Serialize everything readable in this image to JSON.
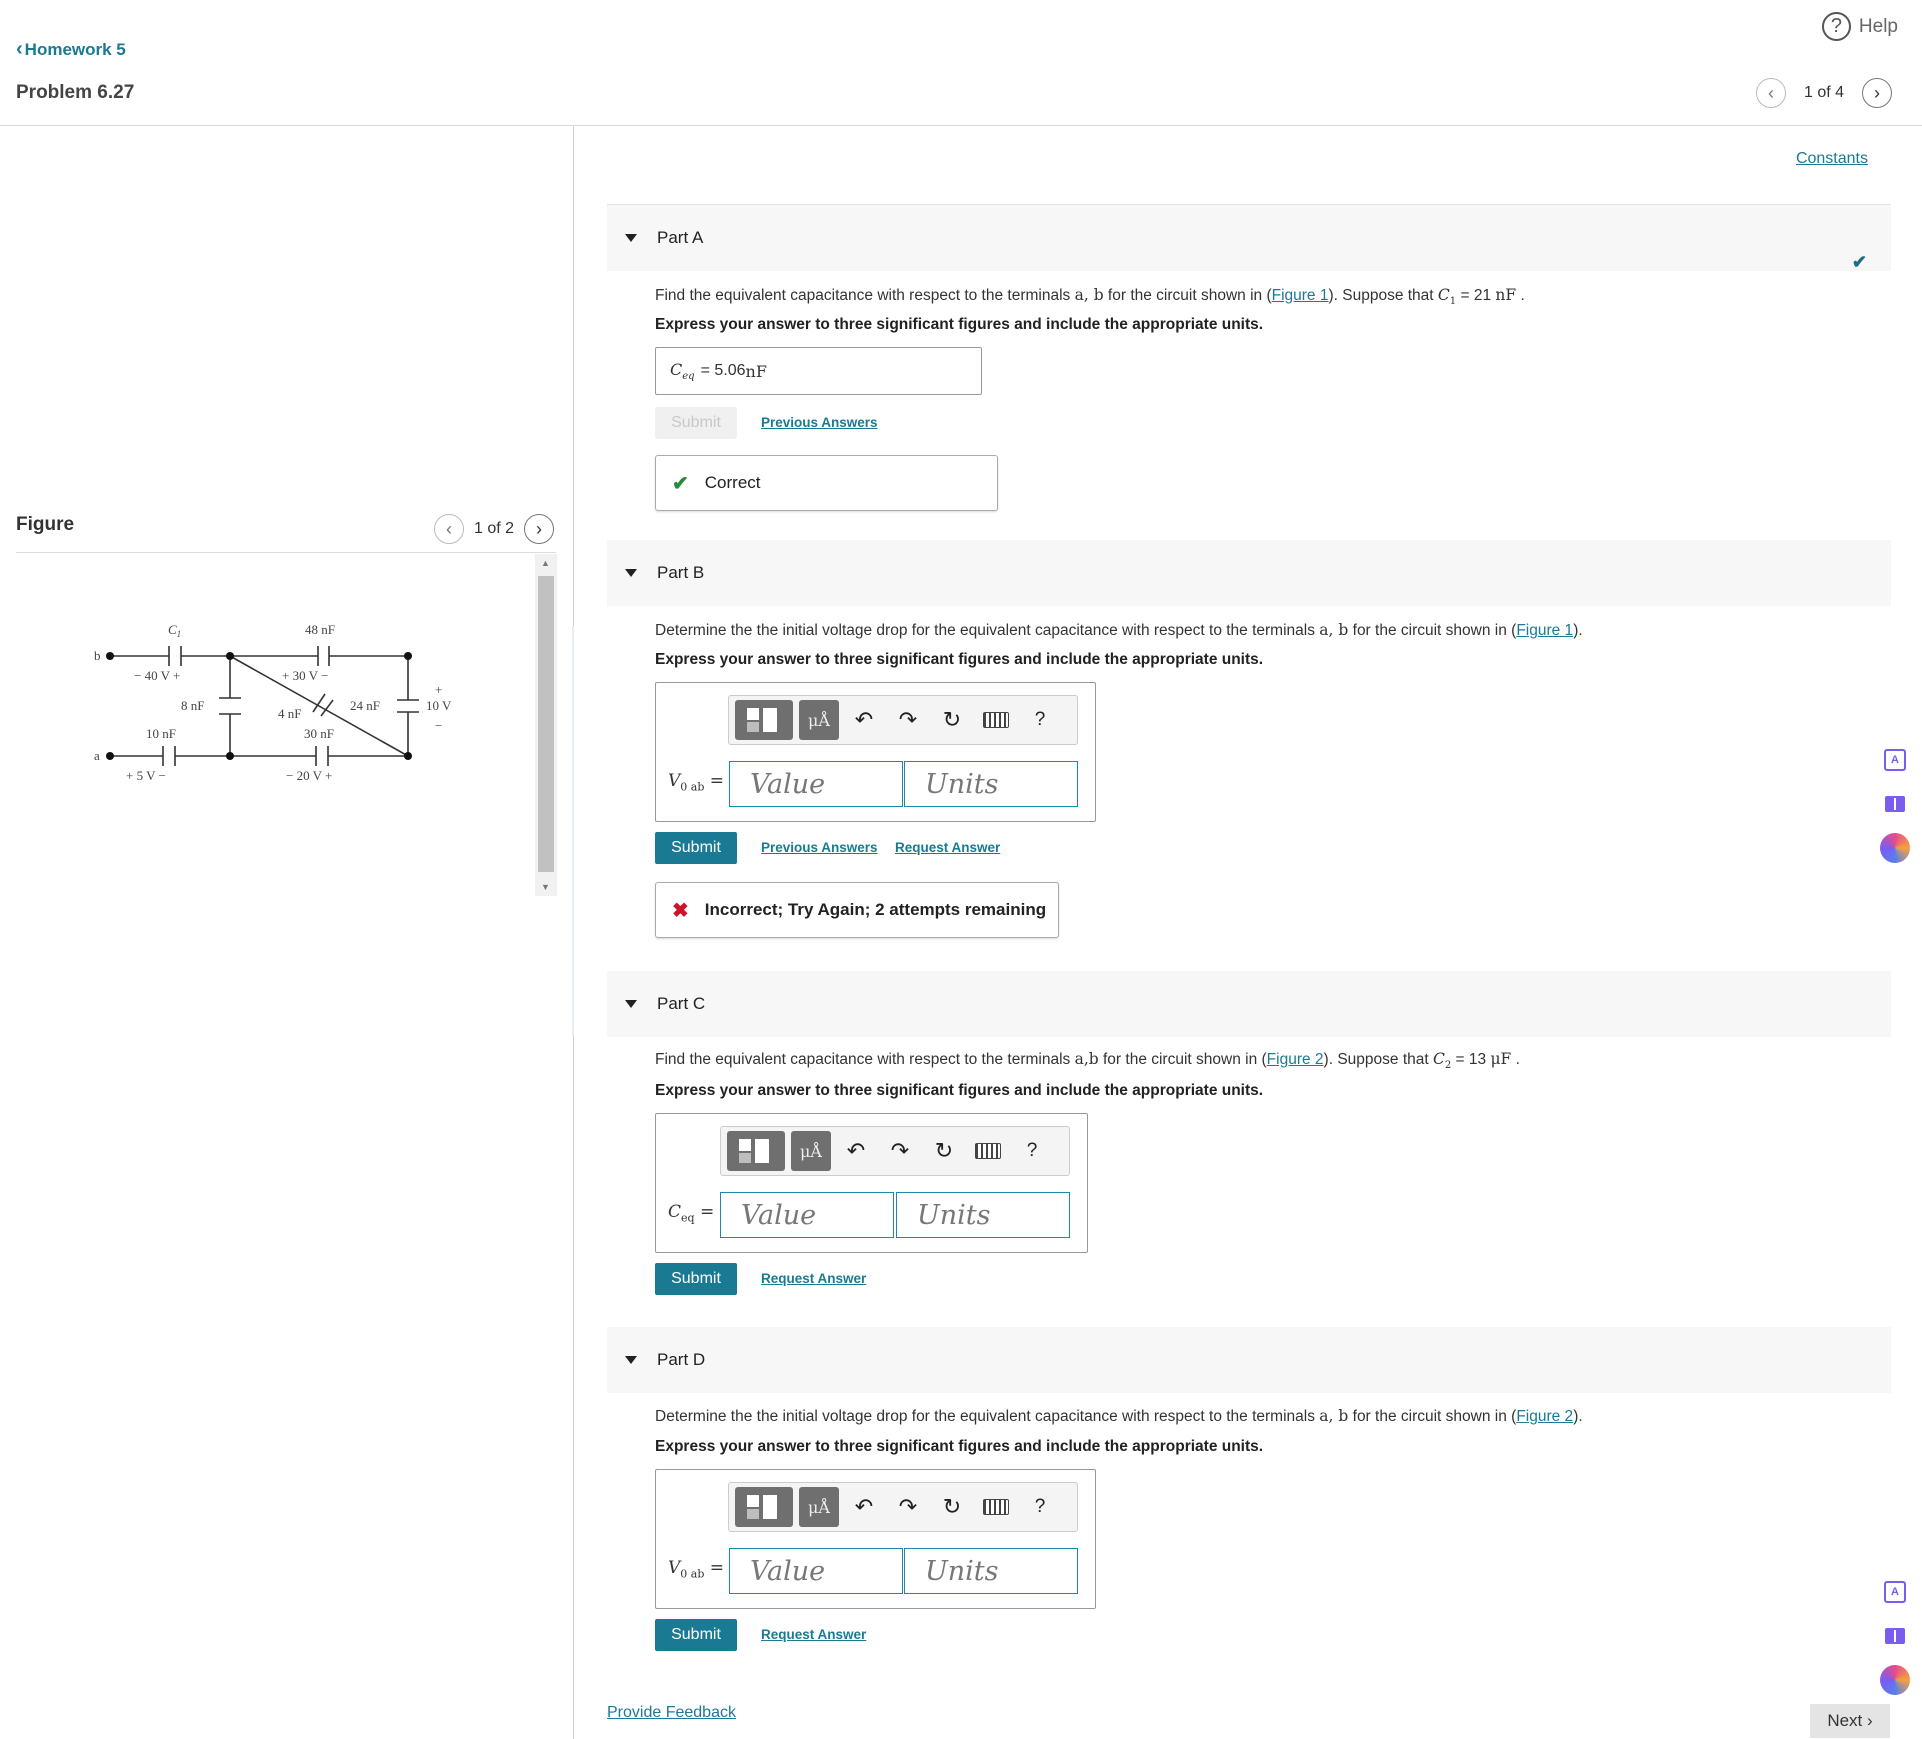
{
  "header": {
    "back_label": "Homework 5",
    "problem_title": "Problem 6.27",
    "help_label": "Help",
    "pager_text": "1 of 4"
  },
  "figure": {
    "label": "Figure",
    "pager_text": "1 of 2",
    "circuit": {
      "c1_label": "C",
      "c1_sub": "1",
      "c48_label": "48 nF",
      "v40_label": "− 40 V  +",
      "v30_label": "+  30 V  −",
      "c8_label": "8 nF",
      "c4_label": "4 nF",
      "c24_label": "24 nF",
      "v10_plus": "+",
      "v10_label": "10 V",
      "v10_minus": "−",
      "c10_label": "10 nF",
      "c30_label": "30 nF",
      "v5_label": "+  5 V  −",
      "v20_label": "−  20 V  +",
      "node_b": "b",
      "node_a": "a"
    }
  },
  "constants_label": "Constants",
  "parts": {
    "a": {
      "title": "Part A",
      "prompt_pre": "Find the equivalent capacitance with respect to the terminals ",
      "prompt_terms": "a, b",
      "prompt_mid": " for the circuit shown in (",
      "figure_link": "Figure 1",
      "prompt_post": "). Suppose that ",
      "given_var": "C",
      "given_sub": "1",
      "given_value": " = 21 ",
      "given_unit": "nF",
      "given_end": " .",
      "instruction": "Express your answer to three significant figures and include the appropriate units.",
      "answer_var": "C",
      "answer_sub": "eq",
      "answer_value": " =  5.06 ",
      "answer_unit": "nF",
      "submit_label": "Submit",
      "previous_answers_label": "Previous Answers",
      "feedback_label": "Correct"
    },
    "b": {
      "title": "Part B",
      "prompt_pre": "Determine the the initial voltage drop for the equivalent capacitance with respect to the terminals ",
      "prompt_terms": "a, b",
      "prompt_mid": " for the circuit shown in (",
      "figure_link": "Figure 1",
      "prompt_post": ").",
      "instruction": "Express your answer to three significant figures and include the appropriate units.",
      "eq_var": "V",
      "eq_sub": "0 ab",
      "eq_sign": " =",
      "value_placeholder": "Value",
      "units_placeholder": "Units",
      "submit_label": "Submit",
      "previous_answers_label": "Previous Answers",
      "request_answer_label": "Request Answer",
      "feedback_label": "Incorrect; Try Again; 2 attempts remaining"
    },
    "c": {
      "title": "Part C",
      "prompt_pre": "Find the equivalent capacitance with respect to the terminals ",
      "prompt_terms": "a,b",
      "prompt_mid": " for the circuit shown in (",
      "figure_link": "Figure 2",
      "prompt_post": "). Suppose that ",
      "given_var": "C",
      "given_sub": "2",
      "given_value": " = 13 ",
      "given_unit": "μF",
      "given_end": " .",
      "instruction": "Express your answer to three significant figures and include the appropriate units.",
      "eq_var": "C",
      "eq_sub": "eq",
      "eq_sign": " =",
      "value_placeholder": "Value",
      "units_placeholder": "Units",
      "submit_label": "Submit",
      "request_answer_label": "Request Answer"
    },
    "d": {
      "title": "Part D",
      "prompt_pre": "Determine the the initial voltage drop for the equivalent capacitance with respect to the terminals ",
      "prompt_terms": "a, b",
      "prompt_mid": " for the circuit shown in (",
      "figure_link": "Figure 2",
      "prompt_post": ").",
      "instruction": "Express your answer to three significant figures and include the appropriate units.",
      "eq_var": "V",
      "eq_sub": "0 ab",
      "eq_sign": " =",
      "value_placeholder": "Value",
      "units_placeholder": "Units",
      "submit_label": "Submit",
      "request_answer_label": "Request Answer"
    }
  },
  "toolbar": {
    "units_glyph": "μÅ",
    "undo_glyph": "↶",
    "redo_glyph": "↷",
    "reset_glyph": "↻",
    "help_glyph": "?"
  },
  "footer": {
    "feedback_label": "Provide Feedback",
    "next_label": "Next ›"
  },
  "colors": {
    "accent": "#1a7a94",
    "correct": "#2a8a3c",
    "incorrect": "#d0112b"
  }
}
